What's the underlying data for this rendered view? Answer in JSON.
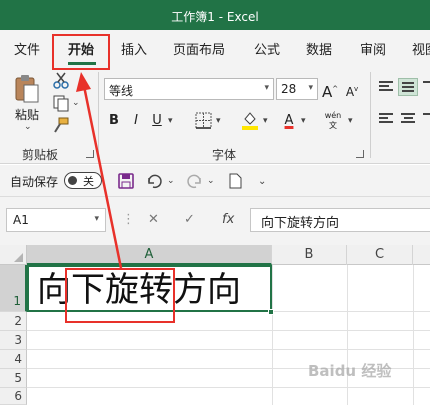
{
  "window": {
    "title": "工作簿1  -  Excel"
  },
  "tabs": [
    {
      "label": "文件"
    },
    {
      "label": "开始",
      "active": true
    },
    {
      "label": "插入"
    },
    {
      "label": "页面布局"
    },
    {
      "label": "公式"
    },
    {
      "label": "数据"
    },
    {
      "label": "审阅"
    },
    {
      "label": "视图"
    }
  ],
  "clipboard": {
    "paste_label": "粘贴",
    "group_label": "剪贴板"
  },
  "font": {
    "name": "等线",
    "size": "28",
    "bold_label": "B",
    "italic_label": "I",
    "underline_label": "U",
    "increase_label": "A",
    "decrease_label": "A",
    "phonetic_label": "wén",
    "group_label": "字体",
    "fill_color": "#ffe600",
    "font_color": "#e8312a"
  },
  "qat": {
    "autosave_label": "自动保存",
    "toggle_label": "关"
  },
  "formula_bar": {
    "name_box": "A1",
    "fx_label": "fx",
    "content": "向下旋转方向"
  },
  "grid": {
    "columns": [
      "A",
      "B",
      "C"
    ],
    "rows": [
      "1",
      "2",
      "3",
      "4",
      "5",
      "6"
    ],
    "cell_a1": "向下旋转方向"
  },
  "colors": {
    "excel_green": "#217346",
    "annotation_red": "#e8312a"
  },
  "watermark": "Baidu 经验"
}
